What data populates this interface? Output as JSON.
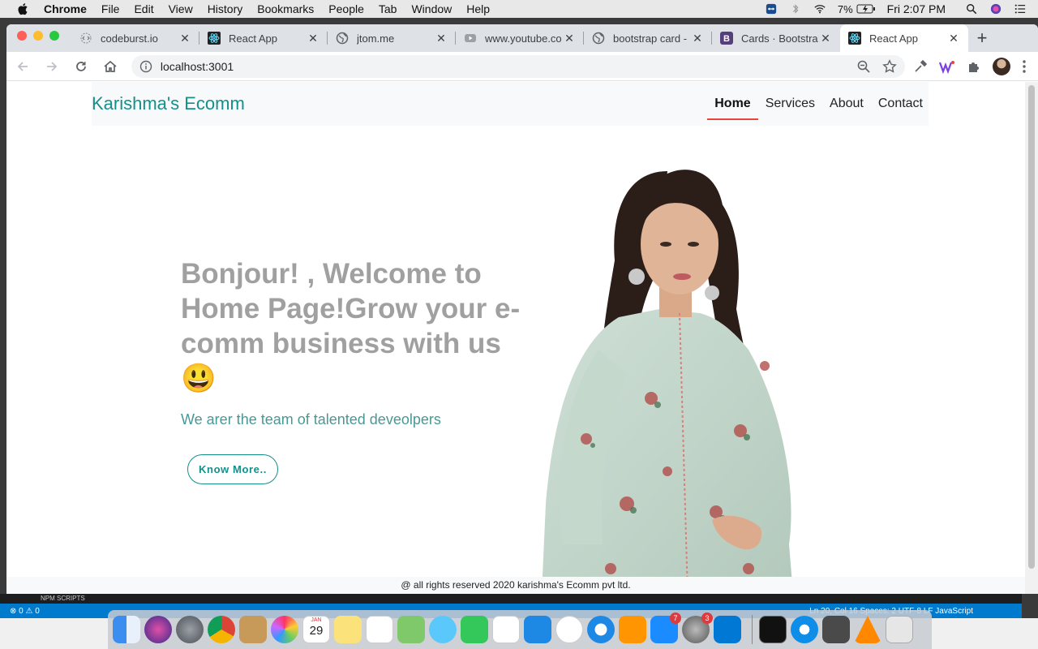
{
  "menubar": {
    "app_name": "Chrome",
    "items": [
      "File",
      "Edit",
      "View",
      "History",
      "Bookmarks",
      "People",
      "Tab",
      "Window",
      "Help"
    ],
    "battery": "7%",
    "clock": "Fri 2:07 PM"
  },
  "tabs": [
    {
      "title": "codeburst.io",
      "icon": "codeburst-icon"
    },
    {
      "title": "React App",
      "icon": "react-icon"
    },
    {
      "title": "jtom.me",
      "icon": "globe-icon"
    },
    {
      "title": "www.youtube.co",
      "icon": "youtube-icon"
    },
    {
      "title": "bootstrap card -",
      "icon": "globe-icon"
    },
    {
      "title": "Cards · Bootstra",
      "icon": "bootstrap-icon"
    },
    {
      "title": "React App",
      "icon": "react-icon",
      "active": true
    }
  ],
  "address_bar": {
    "url": "localhost:3001"
  },
  "page": {
    "brand": "Karishma's Ecomm",
    "nav": [
      "Home",
      "Services",
      "About",
      "Contact"
    ],
    "hero_title": "Bonjour! , Welcome to Home Page!Grow your e-comm business with us 😃",
    "hero_subtitle": "We arer the team of talented deveolpers",
    "cta_label": "Know More..",
    "footer": "@ all rights reserved 2020 karishma's Ecomm pvt ltd."
  },
  "vscode": {
    "panel_label": "NPM SCRIPTS",
    "status_left": "⊗ 0 ⚠ 0",
    "status_right": "Ln 20, Col 16   Spaces: 2   UTF-8   LF   JavaScript"
  },
  "dock": {
    "calendar_day": "29",
    "calendar_month": "JAN",
    "appstore_badge": "7",
    "prefs_badge": "3"
  },
  "colors": {
    "brand": "#14908a",
    "active_underline": "#e8453c",
    "hero_title": "#a0a0a0"
  }
}
